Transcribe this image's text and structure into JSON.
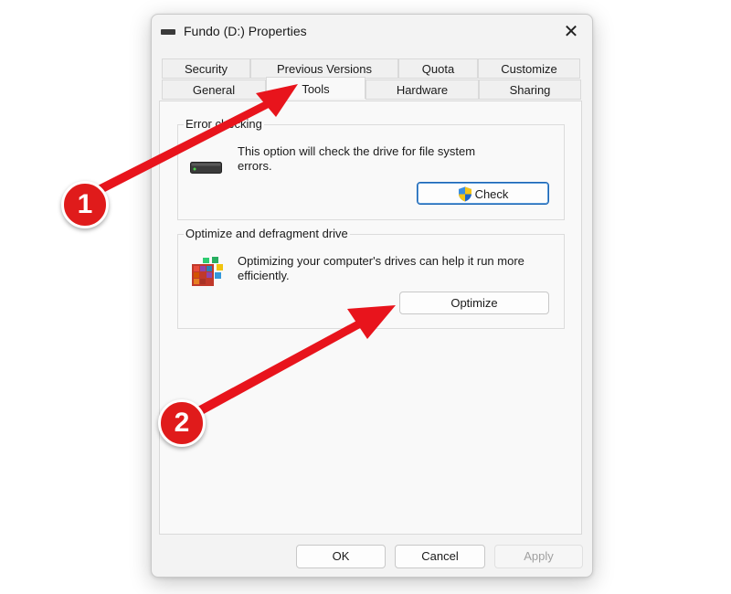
{
  "window": {
    "title": "Fundo (D:) Properties",
    "close_glyph": "✕"
  },
  "tabs": {
    "row1": [
      "Security",
      "Previous Versions",
      "Quota",
      "Customize"
    ],
    "row2": [
      "General",
      "Tools",
      "Hardware",
      "Sharing"
    ],
    "active": "Tools"
  },
  "error_checking": {
    "group_label": "Error checking",
    "description": "This option will check the drive for file system errors.",
    "button_label": "Check"
  },
  "optimize": {
    "group_label": "Optimize and defragment drive",
    "description": "Optimizing your computer's drives can help it run more efficiently.",
    "button_label": "Optimize"
  },
  "footer": {
    "ok_label": "OK",
    "cancel_label": "Cancel",
    "apply_label": "Apply"
  },
  "annotations": {
    "step1": "1",
    "step2": "2",
    "color": "#e01b1b"
  },
  "icons": {
    "title": "drive-icon",
    "drive": "hard-drive-icon",
    "shield": "uac-shield-icon",
    "defrag": "defrag-icon",
    "close": "close-icon"
  }
}
